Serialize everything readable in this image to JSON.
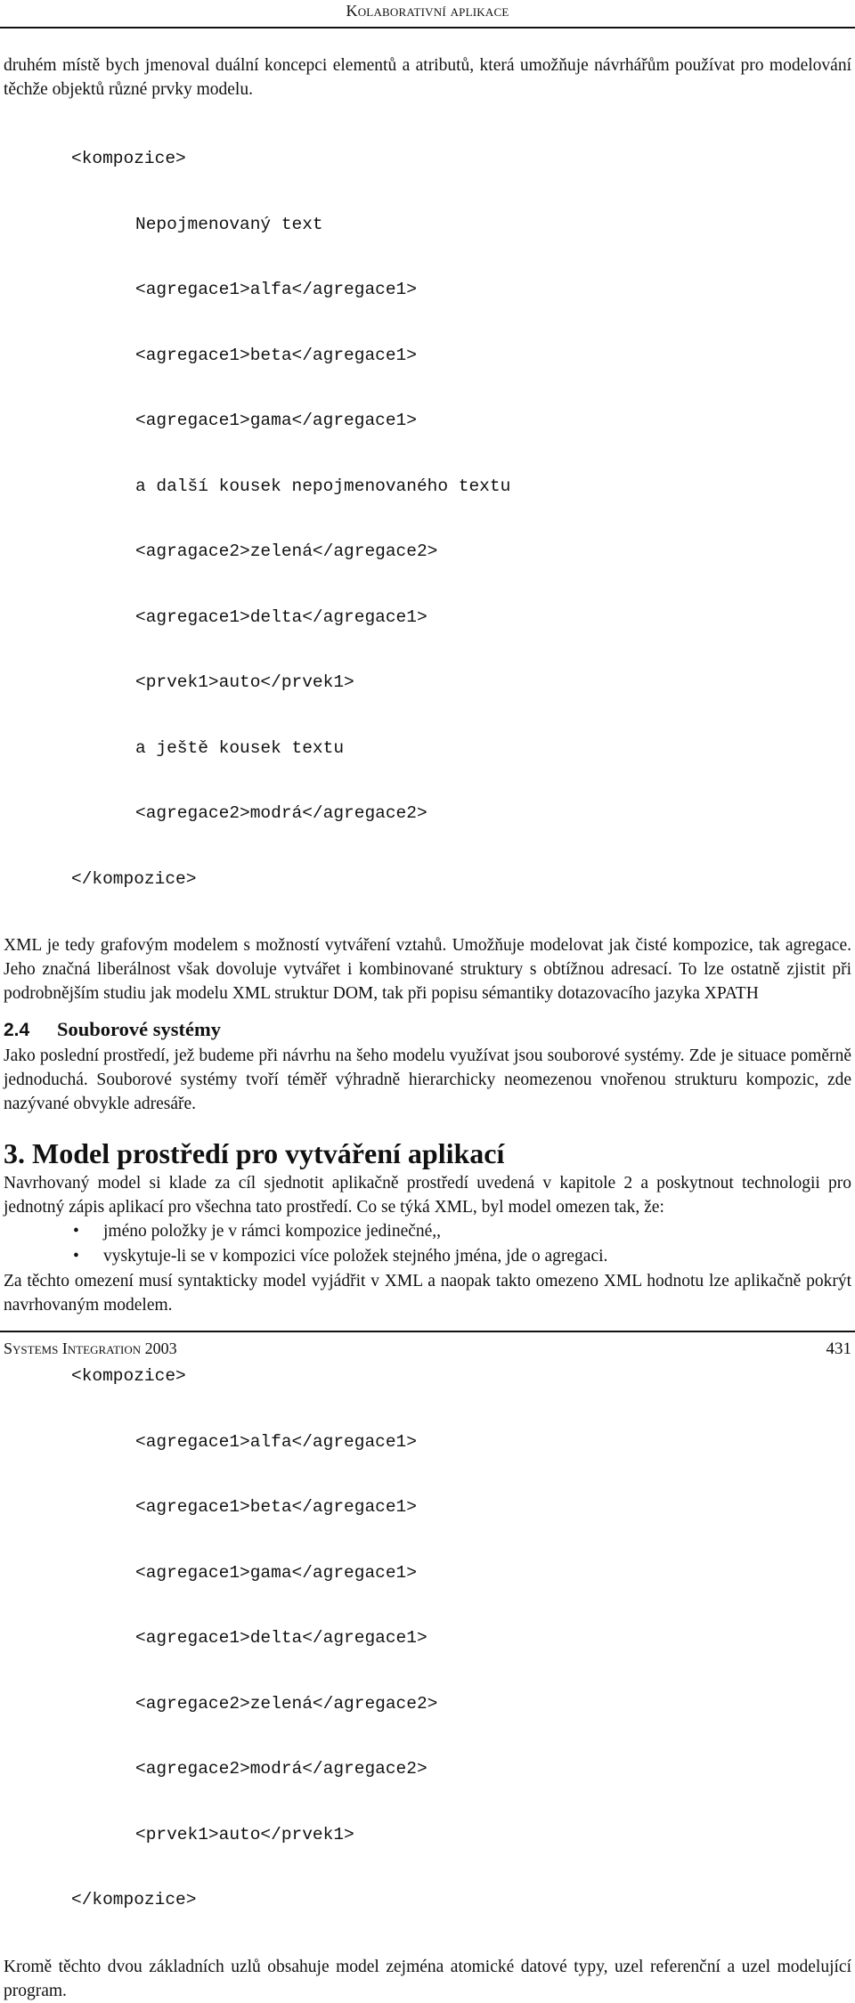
{
  "header": {
    "running_title": "Kolaborativní aplikace"
  },
  "intro_paragraph": "druhém místě bych jmenoval duální koncepci elementů a atributů, která umožňuje návrhářům používat pro modelování těchže objektů různé prvky modelu.",
  "code_example_1": {
    "open_tag": "<kompozice>",
    "lines": [
      "Nepojmenovaný text",
      "<agregace1>alfa</agregace1>",
      "<agregace1>beta</agregace1>",
      "<agregace1>gama</agregace1>",
      "a další kousek nepojmenovaného textu",
      "<agragace2>zelená</agregace2>",
      "<agregace1>delta</agregace1>",
      "<prvek1>auto</prvek1>",
      "a ještě kousek textu",
      "<agregace2>modrá</agregace2>"
    ],
    "close_tag": "</kompozice>"
  },
  "xml_paragraph": "XML je tedy grafovým modelem s možností vytváření vztahů. Umožňuje modelovat jak čisté kompozice, tak agregace. Jeho značná liberálnost však dovoluje vytvářet i kombinované struktury s obtížnou adresací. To lze ostatně zjistit při podrobnějším studiu jak modelu XML struktur DOM, tak při popisu sémantiky dotazovacího jazyka XPATH",
  "section_2_4": {
    "number": "2.4",
    "title": "Souborové systémy",
    "paragraph": "Jako poslední prostředí, jež budeme při návrhu na šeho modelu využívat jsou souborové systémy. Zde je situace poměrně jednoduchá. Souborové systémy tvoří téměř výhradně hierarchicky neomezenou vnořenou strukturu kompozic, zde nazývané obvykle adresáře."
  },
  "chapter_3": {
    "title": "3. Model prostředí pro vytváření aplikací",
    "paragraph": "Navrhovaný model si klade za cíl sjednotit aplikačně prostředí uvedená v kapitole 2 a poskytnout technologii pro jednotný zápis aplikací pro všechna tato prostředí. Co se týká XML, byl model omezen tak, že:",
    "bullet_symbol": "•",
    "bullets": [
      "jméno položky je v rámci kompozice jedinečné,,",
      "vyskytuje-li se v kompozici více položek stejného jména, jde o agregaci."
    ],
    "paragraph_2": "Za těchto omezení musí syntakticky model vyjádřit v XML a naopak takto omezeno XML hodnotu lze aplikačně pokrýt navrhovaným modelem.",
    "code_example_2": {
      "open_tag": "<kompozice>",
      "lines": [
        "<agregace1>alfa</agregace1>",
        "<agregace1>beta</agregace1>",
        "<agregace1>gama</agregace1>",
        "<agregace1>delta</agregace1>",
        "<agregace2>zelená</agregace2>",
        "<agregace2>modrá</agregace2>",
        "<prvek1>auto</prvek1>"
      ],
      "close_tag": "</kompozice>"
    },
    "paragraph_3": "Kromě těchto dvou základních uzlů obsahuje model zejména atomické datové typy, uzel referenční a uzel modelující program."
  },
  "footer": {
    "running_title": "Systems Integration 2003",
    "page_number": "431"
  }
}
